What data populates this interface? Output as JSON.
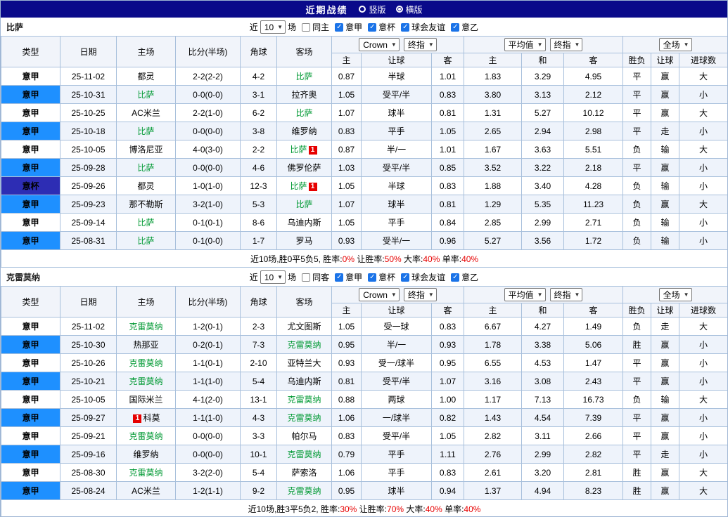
{
  "title_bar": {
    "title": "近期战绩",
    "radio_vertical": "竖版",
    "radio_horizontal": "横版"
  },
  "colors": {
    "title_bar": "#0a0a8a",
    "league_serie_a": "#1e90ff",
    "league_cup": "#2d2db4",
    "focus_team": "#009933",
    "score": "#e60000",
    "odds": "#00008b",
    "win": "#e60000",
    "draw": "#009933",
    "lose": "#1515cc",
    "checkbox": "#1a73e8"
  },
  "header": {
    "near": "近",
    "games": "10",
    "games_suffix": "场",
    "col_type": "类型",
    "col_date": "日期",
    "col_home": "主场",
    "col_score": "比分(半场)",
    "col_corner": "角球",
    "col_away": "客场",
    "select_odds_1": "Crown",
    "select_odds_2": "终指",
    "select_avg_1": "平均值",
    "select_avg_2": "终指",
    "select_result": "全场",
    "sub_home": "主",
    "sub_handicap": "让球",
    "sub_away": "客",
    "sub_avg_home": "主",
    "sub_avg_draw": "和",
    "sub_avg_away": "客",
    "sub_result": "胜负",
    "sub_handicap_result": "让球",
    "sub_goals": "进球数"
  },
  "sections": [
    {
      "team": "比萨",
      "checkboxes": [
        {
          "label": "同主",
          "checked": false
        },
        {
          "label": "意甲",
          "checked": true
        },
        {
          "label": "意杯",
          "checked": true
        },
        {
          "label": "球会友谊",
          "checked": true
        },
        {
          "label": "意乙",
          "checked": true
        }
      ],
      "rows": [
        {
          "type": "意甲",
          "tc": "jia",
          "date": "25-11-02",
          "home": "都灵",
          "hf": false,
          "hb": "",
          "hbp": "",
          "score": "2-2(2-2)",
          "corner": "4-2",
          "away": "比萨",
          "af": true,
          "ab": "",
          "abp": "",
          "o1": "0.87",
          "o2": "半球",
          "o3": "1.01",
          "a1": "1.83",
          "a2": "3.29",
          "a3": "4.95",
          "r": [
            "平",
            "g"
          ],
          "l": [
            "赢",
            "r"
          ],
          "g": [
            "大",
            "r"
          ]
        },
        {
          "type": "意甲",
          "tc": "jia",
          "date": "25-10-31",
          "home": "比萨",
          "hf": true,
          "hb": "",
          "hbp": "",
          "score": "0-0(0-0)",
          "corner": "3-1",
          "away": "拉齐奥",
          "af": false,
          "ab": "",
          "abp": "",
          "o1": "1.05",
          "o2": "受平/半",
          "o3": "0.83",
          "a1": "3.80",
          "a2": "3.13",
          "a3": "2.12",
          "r": [
            "平",
            "g"
          ],
          "l": [
            "赢",
            "r"
          ],
          "g": [
            "小",
            "g"
          ]
        },
        {
          "type": "意甲",
          "tc": "jia",
          "date": "25-10-25",
          "home": "AC米兰",
          "hf": false,
          "hb": "",
          "hbp": "",
          "score": "2-2(1-0)",
          "corner": "6-2",
          "away": "比萨",
          "af": true,
          "ab": "",
          "abp": "",
          "o1": "1.07",
          "o2": "球半",
          "o3": "0.81",
          "a1": "1.31",
          "a2": "5.27",
          "a3": "10.12",
          "r": [
            "平",
            "g"
          ],
          "l": [
            "赢",
            "r"
          ],
          "g": [
            "大",
            "r"
          ]
        },
        {
          "type": "意甲",
          "tc": "jia",
          "date": "25-10-18",
          "home": "比萨",
          "hf": true,
          "hb": "",
          "hbp": "",
          "score": "0-0(0-0)",
          "corner": "3-8",
          "away": "维罗纳",
          "af": false,
          "ab": "",
          "abp": "",
          "o1": "0.83",
          "o2": "平手",
          "o3": "1.05",
          "a1": "2.65",
          "a2": "2.94",
          "a3": "2.98",
          "r": [
            "平",
            "g"
          ],
          "l": [
            "走",
            "g"
          ],
          "g": [
            "小",
            "g"
          ]
        },
        {
          "type": "意甲",
          "tc": "jia",
          "date": "25-10-05",
          "home": "博洛尼亚",
          "hf": false,
          "hb": "",
          "hbp": "",
          "score": "4-0(3-0)",
          "corner": "2-2",
          "away": "比萨",
          "af": true,
          "ab": "1",
          "abp": "r",
          "o1": "0.87",
          "o2": "半/一",
          "o3": "1.01",
          "a1": "1.67",
          "a2": "3.63",
          "a3": "5.51",
          "r": [
            "负",
            "b"
          ],
          "l": [
            "输",
            "b"
          ],
          "g": [
            "大",
            "r"
          ]
        },
        {
          "type": "意甲",
          "tc": "jia",
          "date": "25-09-28",
          "home": "比萨",
          "hf": true,
          "hb": "",
          "hbp": "",
          "score": "0-0(0-0)",
          "corner": "4-6",
          "away": "佛罗伦萨",
          "af": false,
          "ab": "",
          "abp": "",
          "o1": "1.03",
          "o2": "受平/半",
          "o3": "0.85",
          "a1": "3.52",
          "a2": "3.22",
          "a3": "2.18",
          "r": [
            "平",
            "g"
          ],
          "l": [
            "赢",
            "r"
          ],
          "g": [
            "小",
            "g"
          ]
        },
        {
          "type": "意杯",
          "tc": "bei",
          "date": "25-09-26",
          "home": "都灵",
          "hf": false,
          "hb": "",
          "hbp": "",
          "score": "1-0(1-0)",
          "corner": "12-3",
          "away": "比萨",
          "af": true,
          "ab": "1",
          "abp": "r",
          "o1": "1.05",
          "o2": "半球",
          "o3": "0.83",
          "a1": "1.88",
          "a2": "3.40",
          "a3": "4.28",
          "r": [
            "负",
            "b"
          ],
          "l": [
            "输",
            "b"
          ],
          "g": [
            "小",
            "g"
          ]
        },
        {
          "type": "意甲",
          "tc": "jia",
          "date": "25-09-23",
          "home": "那不勒斯",
          "hf": false,
          "hb": "",
          "hbp": "",
          "score": "3-2(1-0)",
          "corner": "5-3",
          "away": "比萨",
          "af": true,
          "ab": "",
          "abp": "",
          "o1": "1.07",
          "o2": "球半",
          "o3": "0.81",
          "a1": "1.29",
          "a2": "5.35",
          "a3": "11.23",
          "r": [
            "负",
            "b"
          ],
          "l": [
            "赢",
            "r"
          ],
          "g": [
            "大",
            "r"
          ]
        },
        {
          "type": "意甲",
          "tc": "jia",
          "date": "25-09-14",
          "home": "比萨",
          "hf": true,
          "hb": "",
          "hbp": "",
          "score": "0-1(0-1)",
          "corner": "8-6",
          "away": "乌迪内斯",
          "af": false,
          "ab": "",
          "abp": "",
          "o1": "1.05",
          "o2": "平手",
          "o3": "0.84",
          "a1": "2.85",
          "a2": "2.99",
          "a3": "2.71",
          "r": [
            "负",
            "b"
          ],
          "l": [
            "输",
            "b"
          ],
          "g": [
            "小",
            "g"
          ]
        },
        {
          "type": "意甲",
          "tc": "jia",
          "date": "25-08-31",
          "home": "比萨",
          "hf": true,
          "hb": "",
          "hbp": "",
          "score": "0-1(0-0)",
          "corner": "1-7",
          "away": "罗马",
          "af": false,
          "ab": "",
          "abp": "",
          "o1": "0.93",
          "o2": "受半/一",
          "o3": "0.96",
          "a1": "5.27",
          "a2": "3.56",
          "a3": "1.72",
          "r": [
            "负",
            "b"
          ],
          "l": [
            "输",
            "b"
          ],
          "g": [
            "小",
            "g"
          ]
        }
      ],
      "summary": [
        {
          "t": "近10场,胜0平5负5, 胜率:",
          "c": "k"
        },
        {
          "t": "0%",
          "c": "r"
        },
        {
          "t": " 让胜率:",
          "c": "k"
        },
        {
          "t": "50%",
          "c": "r"
        },
        {
          "t": " 大率:",
          "c": "k"
        },
        {
          "t": "40%",
          "c": "r"
        },
        {
          "t": " 单率:",
          "c": "k"
        },
        {
          "t": "40%",
          "c": "r"
        }
      ]
    },
    {
      "team": "克雷莫纳",
      "checkboxes": [
        {
          "label": "同客",
          "checked": false
        },
        {
          "label": "意甲",
          "checked": true
        },
        {
          "label": "意杯",
          "checked": true
        },
        {
          "label": "球会友谊",
          "checked": true
        },
        {
          "label": "意乙",
          "checked": true
        }
      ],
      "rows": [
        {
          "type": "意甲",
          "tc": "jia",
          "date": "25-11-02",
          "home": "克雷莫纳",
          "hf": true,
          "hb": "",
          "hbp": "",
          "score": "1-2(0-1)",
          "corner": "2-3",
          "away": "尤文图斯",
          "af": false,
          "ab": "",
          "abp": "",
          "o1": "1.05",
          "o2": "受一球",
          "o3": "0.83",
          "a1": "6.67",
          "a2": "4.27",
          "a3": "1.49",
          "r": [
            "负",
            "b"
          ],
          "l": [
            "走",
            "g"
          ],
          "g": [
            "大",
            "r"
          ]
        },
        {
          "type": "意甲",
          "tc": "jia",
          "date": "25-10-30",
          "home": "热那亚",
          "hf": false,
          "hb": "",
          "hbp": "",
          "score": "0-2(0-1)",
          "corner": "7-3",
          "away": "克雷莫纳",
          "af": true,
          "ab": "",
          "abp": "",
          "o1": "0.95",
          "o2": "半/一",
          "o3": "0.93",
          "a1": "1.78",
          "a2": "3.38",
          "a3": "5.06",
          "r": [
            "胜",
            "r"
          ],
          "l": [
            "赢",
            "r"
          ],
          "g": [
            "小",
            "g"
          ]
        },
        {
          "type": "意甲",
          "tc": "jia",
          "date": "25-10-26",
          "home": "克雷莫纳",
          "hf": true,
          "hb": "",
          "hbp": "",
          "score": "1-1(0-1)",
          "corner": "2-10",
          "away": "亚特兰大",
          "af": false,
          "ab": "",
          "abp": "",
          "o1": "0.93",
          "o2": "受一/球半",
          "o3": "0.95",
          "a1": "6.55",
          "a2": "4.53",
          "a3": "1.47",
          "r": [
            "平",
            "g"
          ],
          "l": [
            "赢",
            "r"
          ],
          "g": [
            "小",
            "g"
          ]
        },
        {
          "type": "意甲",
          "tc": "jia",
          "date": "25-10-21",
          "home": "克雷莫纳",
          "hf": true,
          "hb": "",
          "hbp": "",
          "score": "1-1(1-0)",
          "corner": "5-4",
          "away": "乌迪内斯",
          "af": false,
          "ab": "",
          "abp": "",
          "o1": "0.81",
          "o2": "受平/半",
          "o3": "1.07",
          "a1": "3.16",
          "a2": "3.08",
          "a3": "2.43",
          "r": [
            "平",
            "g"
          ],
          "l": [
            "赢",
            "r"
          ],
          "g": [
            "小",
            "g"
          ]
        },
        {
          "type": "意甲",
          "tc": "jia",
          "date": "25-10-05",
          "home": "国际米兰",
          "hf": false,
          "hb": "",
          "hbp": "",
          "score": "4-1(2-0)",
          "corner": "13-1",
          "away": "克雷莫纳",
          "af": true,
          "ab": "",
          "abp": "",
          "o1": "0.88",
          "o2": "两球",
          "o3": "1.00",
          "a1": "1.17",
          "a2": "7.13",
          "a3": "16.73",
          "r": [
            "负",
            "b"
          ],
          "l": [
            "输",
            "b"
          ],
          "g": [
            "大",
            "r"
          ]
        },
        {
          "type": "意甲",
          "tc": "jia",
          "date": "25-09-27",
          "home": "科莫",
          "hf": false,
          "hb": "1",
          "hbp": "l",
          "score": "1-1(1-0)",
          "corner": "4-3",
          "away": "克雷莫纳",
          "af": true,
          "ab": "",
          "abp": "",
          "o1": "1.06",
          "o2": "一/球半",
          "o3": "0.82",
          "a1": "1.43",
          "a2": "4.54",
          "a3": "7.39",
          "r": [
            "平",
            "g"
          ],
          "l": [
            "赢",
            "r"
          ],
          "g": [
            "小",
            "g"
          ]
        },
        {
          "type": "意甲",
          "tc": "jia",
          "date": "25-09-21",
          "home": "克雷莫纳",
          "hf": true,
          "hb": "",
          "hbp": "",
          "score": "0-0(0-0)",
          "corner": "3-3",
          "away": "帕尔马",
          "af": false,
          "ab": "",
          "abp": "",
          "o1": "0.83",
          "o2": "受平/半",
          "o3": "1.05",
          "a1": "2.82",
          "a2": "3.11",
          "a3": "2.66",
          "r": [
            "平",
            "g"
          ],
          "l": [
            "赢",
            "r"
          ],
          "g": [
            "小",
            "g"
          ]
        },
        {
          "type": "意甲",
          "tc": "jia",
          "date": "25-09-16",
          "home": "维罗纳",
          "hf": false,
          "hb": "",
          "hbp": "",
          "score": "0-0(0-0)",
          "corner": "10-1",
          "away": "克雷莫纳",
          "af": true,
          "ab": "",
          "abp": "",
          "o1": "0.79",
          "o2": "平手",
          "o3": "1.11",
          "a1": "2.76",
          "a2": "2.99",
          "a3": "2.82",
          "r": [
            "平",
            "g"
          ],
          "l": [
            "走",
            "g"
          ],
          "g": [
            "小",
            "g"
          ]
        },
        {
          "type": "意甲",
          "tc": "jia",
          "date": "25-08-30",
          "home": "克雷莫纳",
          "hf": true,
          "hb": "",
          "hbp": "",
          "score": "3-2(2-0)",
          "corner": "5-4",
          "away": "萨索洛",
          "af": false,
          "ab": "",
          "abp": "",
          "o1": "1.06",
          "o2": "平手",
          "o3": "0.83",
          "a1": "2.61",
          "a2": "3.20",
          "a3": "2.81",
          "r": [
            "胜",
            "r"
          ],
          "l": [
            "赢",
            "r"
          ],
          "g": [
            "大",
            "r"
          ]
        },
        {
          "type": "意甲",
          "tc": "jia",
          "date": "25-08-24",
          "home": "AC米兰",
          "hf": false,
          "hb": "",
          "hbp": "",
          "score": "1-2(1-1)",
          "corner": "9-2",
          "away": "克雷莫纳",
          "af": true,
          "ab": "",
          "abp": "",
          "o1": "0.95",
          "o2": "球半",
          "o3": "0.94",
          "a1": "1.37",
          "a2": "4.94",
          "a3": "8.23",
          "r": [
            "胜",
            "r"
          ],
          "l": [
            "赢",
            "r"
          ],
          "g": [
            "大",
            "r"
          ]
        }
      ],
      "summary": [
        {
          "t": "近10场,胜3平5负2, 胜率:",
          "c": "k"
        },
        {
          "t": "30%",
          "c": "r"
        },
        {
          "t": " 让胜率:",
          "c": "k"
        },
        {
          "t": "70%",
          "c": "r"
        },
        {
          "t": " 大率:",
          "c": "k"
        },
        {
          "t": "40%",
          "c": "r"
        },
        {
          "t": " 单率:",
          "c": "k"
        },
        {
          "t": "40%",
          "c": "r"
        }
      ]
    }
  ]
}
